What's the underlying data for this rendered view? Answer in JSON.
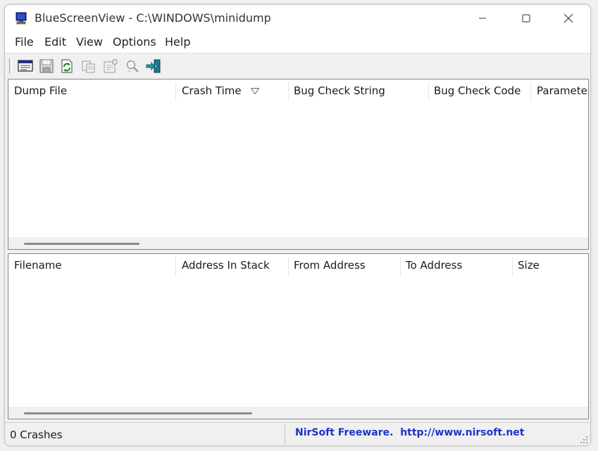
{
  "window": {
    "title": "BlueScreenView  -  C:\\WINDOWS\\minidump"
  },
  "menu": {
    "file": "File",
    "edit": "Edit",
    "view": "View",
    "options": "Options",
    "help": "Help"
  },
  "toolbar": {
    "buttons": [
      {
        "icon": "html-report-icon"
      },
      {
        "icon": "save-icon"
      },
      {
        "icon": "refresh-icon"
      },
      {
        "icon": "copy-icon"
      },
      {
        "icon": "properties-icon"
      },
      {
        "icon": "find-icon"
      },
      {
        "icon": "exit-icon"
      }
    ]
  },
  "crash_list": {
    "columns": [
      "Dump File",
      "Crash Time",
      "Bug Check String",
      "Bug Check Code",
      "Parameter"
    ],
    "sorted_column": "Crash Time",
    "rows": []
  },
  "driver_list": {
    "columns": [
      "Filename",
      "Address In Stack",
      "From Address",
      "To Address",
      "Size"
    ],
    "rows": []
  },
  "status": {
    "count": "0 Crashes",
    "credit": "NirSoft Freeware.  http://www.nirsoft.net"
  },
  "colors": {
    "link": "#1c34c8",
    "toolbar_bg": "#f0f0f0",
    "list_bg": "#ffffff"
  }
}
